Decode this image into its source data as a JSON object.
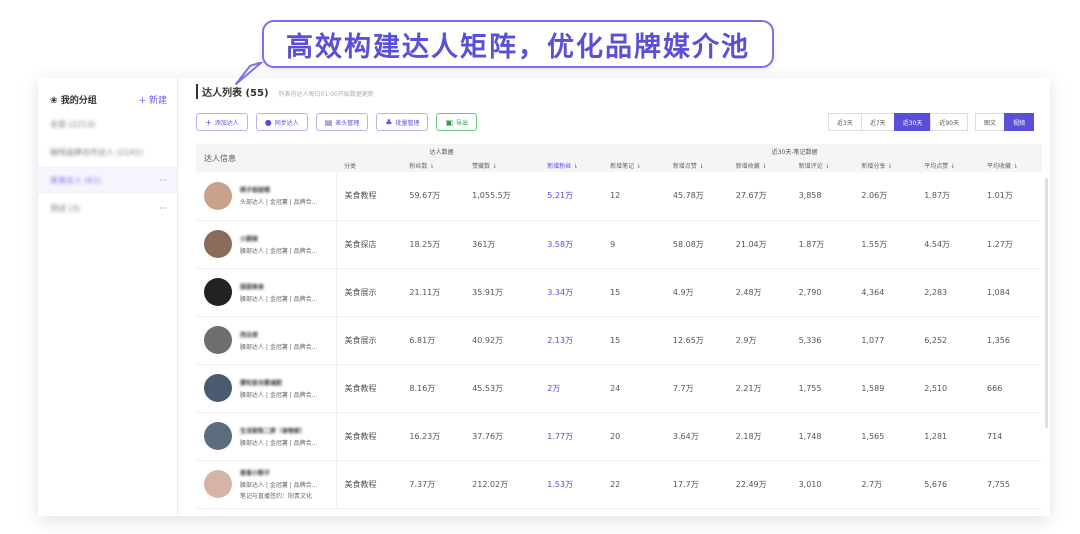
{
  "banner": {
    "text": "高效构建达人矩阵，优化品牌媒介池"
  },
  "sidebar": {
    "header": "我的分组",
    "add_label": "+ 新建",
    "items": [
      {
        "label": "全部 (2213)",
        "active": false,
        "more": ""
      },
      {
        "label": "咖啡品牌合作达人 (2141)",
        "active": false,
        "more": ""
      },
      {
        "label": "美食达人 (61)",
        "active": true,
        "more": "···"
      },
      {
        "label": "测试 (3)",
        "active": false,
        "more": "···"
      }
    ]
  },
  "main": {
    "title": "达人列表 (55)",
    "subtitle": "列表内达人每日01:00开始数据更新",
    "toolbar": {
      "buttons": [
        {
          "icon": "+",
          "label": "添加达人",
          "style": "purple"
        },
        {
          "icon": "●",
          "label": "同步达人",
          "style": "purple"
        },
        {
          "icon": "▤",
          "label": "表头管理",
          "style": "purple"
        },
        {
          "icon": "♣",
          "label": "批量管理",
          "style": "purple"
        },
        {
          "icon": "▣",
          "label": "导出",
          "style": "green"
        }
      ],
      "range_options": [
        {
          "label": "近3天",
          "on": false
        },
        {
          "label": "近7天",
          "on": false
        },
        {
          "label": "近30天",
          "on": true
        },
        {
          "label": "近90天",
          "on": false
        }
      ],
      "note_type_options": [
        {
          "label": "图文",
          "on": false
        },
        {
          "label": "视频",
          "on": true
        }
      ]
    },
    "table": {
      "info_header": "达人信息",
      "group_headers": {
        "kol_data": "达人数据",
        "recent": "近30天-笔记数据"
      },
      "columns": [
        {
          "label": "分类",
          "hl": false
        },
        {
          "label": "粉丝数 ⇂",
          "hl": false
        },
        {
          "label": "赞藏数 ⇂",
          "hl": false
        },
        {
          "label": "新增粉丝 ⇂",
          "hl": true
        },
        {
          "label": "新增笔记 ⇂",
          "hl": false
        },
        {
          "label": "新增点赞 ⇂",
          "hl": false
        },
        {
          "label": "新增收藏 ⇂",
          "hl": false
        },
        {
          "label": "新增评论 ⇂",
          "hl": false
        },
        {
          "label": "新增分享 ⇂",
          "hl": false
        },
        {
          "label": "平均点赞 ⇂",
          "hl": false
        },
        {
          "label": "平均收藏 ⇂",
          "hl": false
        }
      ],
      "rows": [
        {
          "name": "桃子姐姐哦",
          "tags": "头部达人 | 金冠薯 | 品牌合...",
          "extra": "",
          "avatar": "#c9a28a",
          "cells": [
            "美食教程",
            "59.67万",
            "1,055.5万",
            "5.21万",
            "12",
            "45.78万",
            "27.67万",
            "3,858",
            "2.06万",
            "1.87万",
            "1.01万"
          ]
        },
        {
          "name": "小厨娘",
          "tags": "腰部达人 | 金冠薯 | 品牌合...",
          "extra": "",
          "avatar": "#8a6b5a",
          "cells": [
            "美食探店",
            "18.25万",
            "361万",
            "3.58万",
            "9",
            "58.08万",
            "21.04万",
            "1.87万",
            "1.55万",
            "4.54万",
            "1.27万"
          ]
        },
        {
          "name": "甜甜美食",
          "tags": "腰部达人 | 金冠薯 | 品牌合...",
          "extra": "",
          "avatar": "#222222",
          "cells": [
            "美食展示",
            "21.11万",
            "35.91万",
            "3.34万",
            "15",
            "4.9万",
            "2.48万",
            "2,790",
            "4,364",
            "2,283",
            "1,084"
          ]
        },
        {
          "name": "西瓜君",
          "tags": "腰部达人 | 金冠薯 | 品牌合...",
          "extra": "",
          "avatar": "#6f6f6f",
          "cells": [
            "美食展示",
            "6.81万",
            "40.92万",
            "2.13万",
            "15",
            "12.65万",
            "2.9万",
            "5,336",
            "1,077",
            "6,252",
            "1,356"
          ]
        },
        {
          "name": "要吃饭也要减肥",
          "tags": "腰部达人 | 金冠薯 | 品牌合...",
          "extra": "",
          "avatar": "#4a5a70",
          "cells": [
            "美食教程",
            "8.16万",
            "45.53万",
            "2万",
            "24",
            "7.7万",
            "2.21万",
            "1,755",
            "1,589",
            "2,510",
            "666"
          ]
        },
        {
          "name": "生活家陈二胖（食物家）",
          "tags": "腰部达人 | 金冠薯 | 品牌合...",
          "extra": "",
          "avatar": "#5b6b80",
          "cells": [
            "美食教程",
            "16.23万",
            "37.76万",
            "1.77万",
            "20",
            "3.64万",
            "2.18万",
            "1,748",
            "1,565",
            "1,281",
            "714"
          ]
        },
        {
          "name": "香香小粽子",
          "tags": "腰部达人 | 金冠薯 | 品牌合...",
          "extra": "笔记与直播签约：阳青文化",
          "avatar": "#d8b2a6",
          "cells": [
            "美食教程",
            "7.37万",
            "212.02万",
            "1.53万",
            "22",
            "17.7万",
            "22.49万",
            "3,010",
            "2.7万",
            "5,676",
            "7,755"
          ]
        }
      ]
    }
  }
}
